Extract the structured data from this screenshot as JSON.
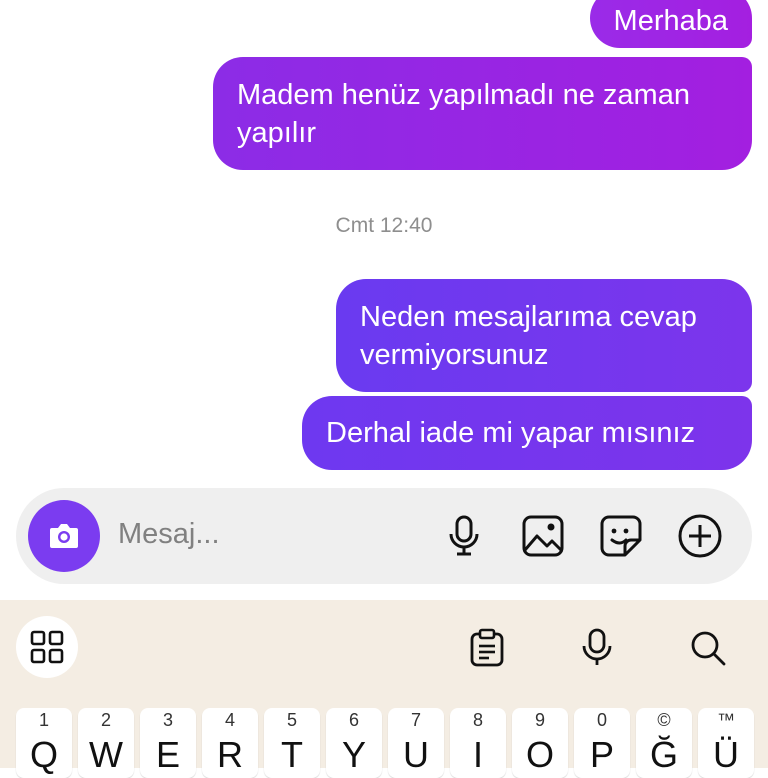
{
  "messages": [
    {
      "text": "Merhaba"
    },
    {
      "text": "Madem henüz yapılmadı ne zaman yapılır"
    },
    {
      "text": "Neden mesajlarıma cevap vermiyorsunuz"
    },
    {
      "text": "Derhal iade mi yapar mısınız"
    }
  ],
  "timestamp": "Cmt 12:40",
  "composer": {
    "placeholder": "Mesaj...",
    "icons": [
      "camera-icon",
      "microphone-icon",
      "image-icon",
      "sticker-icon",
      "plus-circle-icon"
    ]
  },
  "keyboard": {
    "toolbar_icons": [
      "grid-icon",
      "clipboard-icon",
      "microphone-icon",
      "search-icon"
    ],
    "row1": [
      {
        "hint": "1",
        "letter": "Q"
      },
      {
        "hint": "2",
        "letter": "W"
      },
      {
        "hint": "3",
        "letter": "E"
      },
      {
        "hint": "4",
        "letter": "R"
      },
      {
        "hint": "5",
        "letter": "T"
      },
      {
        "hint": "6",
        "letter": "Y"
      },
      {
        "hint": "7",
        "letter": "U"
      },
      {
        "hint": "8",
        "letter": "I"
      },
      {
        "hint": "9",
        "letter": "O"
      },
      {
        "hint": "0",
        "letter": "P"
      },
      {
        "hint": "©",
        "letter": "Ğ"
      },
      {
        "hint": "™",
        "letter": "Ü"
      }
    ]
  },
  "colors": {
    "accent": "#7b3cf0",
    "bubble_purple_dark": "#9a2be8",
    "bubble_violet": "#6e38f0",
    "keyboard_bg": "#f4ede3",
    "composer_bg": "#efefef"
  }
}
